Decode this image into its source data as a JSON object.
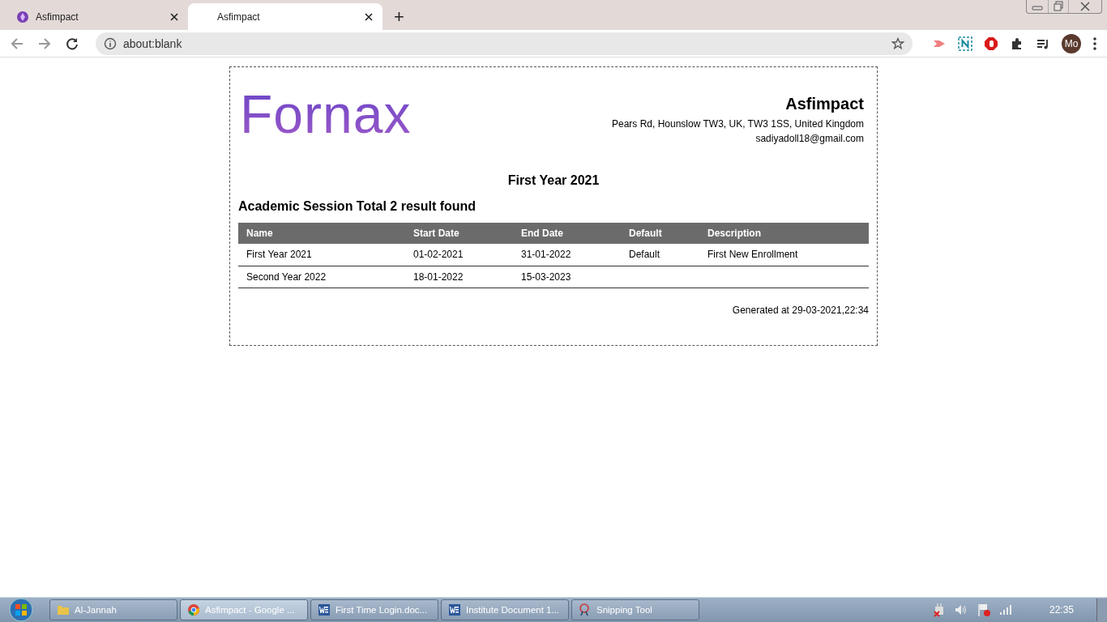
{
  "browser": {
    "tabs": [
      {
        "title": "Asfimpact",
        "selected": false,
        "has_icon": true
      },
      {
        "title": "Asfimpact",
        "selected": true,
        "has_icon": false
      }
    ],
    "new_tab": "+",
    "address": "about:blank",
    "avatar": "Mo"
  },
  "document": {
    "logo": "Fornax",
    "company": {
      "name": "Asfimpact",
      "address": "Pears Rd, Hounslow TW3, UK, TW3 1SS, United Kingdom",
      "email": "sadiyadoll18@gmail.com"
    },
    "title": "First Year 2021",
    "subtitle": "Academic Session Total 2 result found",
    "table": {
      "columns": [
        "Name",
        "Start Date",
        "End Date",
        "Default",
        "Description"
      ],
      "rows": [
        [
          "First Year 2021",
          "01-02-2021",
          "31-01-2022",
          "Default",
          "First New Enrollment"
        ],
        [
          "Second Year 2022",
          "18-01-2022",
          "15-03-2023",
          "",
          ""
        ]
      ]
    },
    "generated": "Generated at 29-03-2021,22:34"
  },
  "taskbar": {
    "items": [
      {
        "label": "Al-Jannah",
        "kind": "folder",
        "selected": false
      },
      {
        "label": "Asfimpact - Google ...",
        "kind": "chrome",
        "selected": true
      },
      {
        "label": "First Time Login.doc...",
        "kind": "word",
        "selected": false
      },
      {
        "label": "Institute Document 1...",
        "kind": "word",
        "selected": false
      },
      {
        "label": "Snipping Tool",
        "kind": "snip",
        "selected": false
      }
    ],
    "clock": "22:35"
  }
}
